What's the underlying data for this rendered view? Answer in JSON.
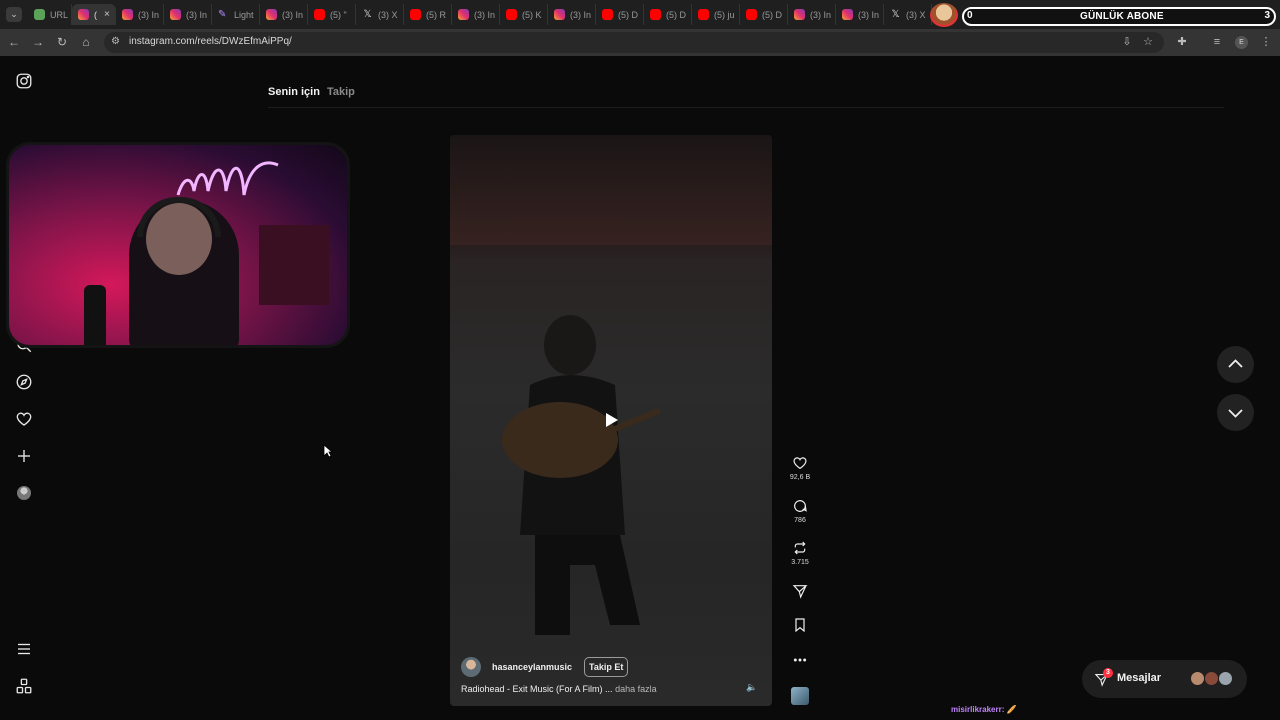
{
  "browser": {
    "tabs": [
      {
        "icon": "url",
        "title": "URL"
      },
      {
        "icon": "instagram",
        "title": "(",
        "active": true
      },
      {
        "icon": "instagram",
        "title": "(3) In"
      },
      {
        "icon": "instagram",
        "title": "(3) In"
      },
      {
        "icon": "light",
        "title": "Light"
      },
      {
        "icon": "instagram",
        "title": "(3) In"
      },
      {
        "icon": "youtube",
        "title": "(5) \""
      },
      {
        "icon": "x",
        "title": "(3) X"
      },
      {
        "icon": "youtube",
        "title": "(5) R"
      },
      {
        "icon": "instagram",
        "title": "(3) In"
      },
      {
        "icon": "youtube",
        "title": "(5) K"
      },
      {
        "icon": "instagram",
        "title": "(3) In"
      },
      {
        "icon": "youtube",
        "title": "(5) D"
      },
      {
        "icon": "youtube",
        "title": "(5) D"
      },
      {
        "icon": "youtube",
        "title": "(5) ju"
      },
      {
        "icon": "youtube",
        "title": "(5) D"
      },
      {
        "icon": "instagram",
        "title": "(3) In"
      },
      {
        "icon": "instagram",
        "title": "(3) In"
      },
      {
        "icon": "x",
        "title": "(3) X"
      }
    ],
    "tab_close": "×",
    "url": "instagram.com/reels/DWzEfmAiPPq/"
  },
  "overlay": {
    "abone_label": "GÜNLÜK ABONE",
    "abone_count": "0",
    "abone_goal": "3",
    "chat_text": "misirlikrakerr: 🥖"
  },
  "feed_tabs": {
    "for_you": "Senin için",
    "following": "Takip"
  },
  "reel": {
    "author": "hasanceylanmusic",
    "follow_label": "Takip Et",
    "caption": "Radiohead - Exit Music (For A Film) ...",
    "more": "daha fazla",
    "likes": "92,6 B",
    "comments": "786",
    "reposts": "3.715"
  },
  "messages": {
    "label": "Mesajlar",
    "badge": "3"
  },
  "colors": {
    "accent_badge": "#ff3040",
    "chat_name": "#c084fc"
  }
}
